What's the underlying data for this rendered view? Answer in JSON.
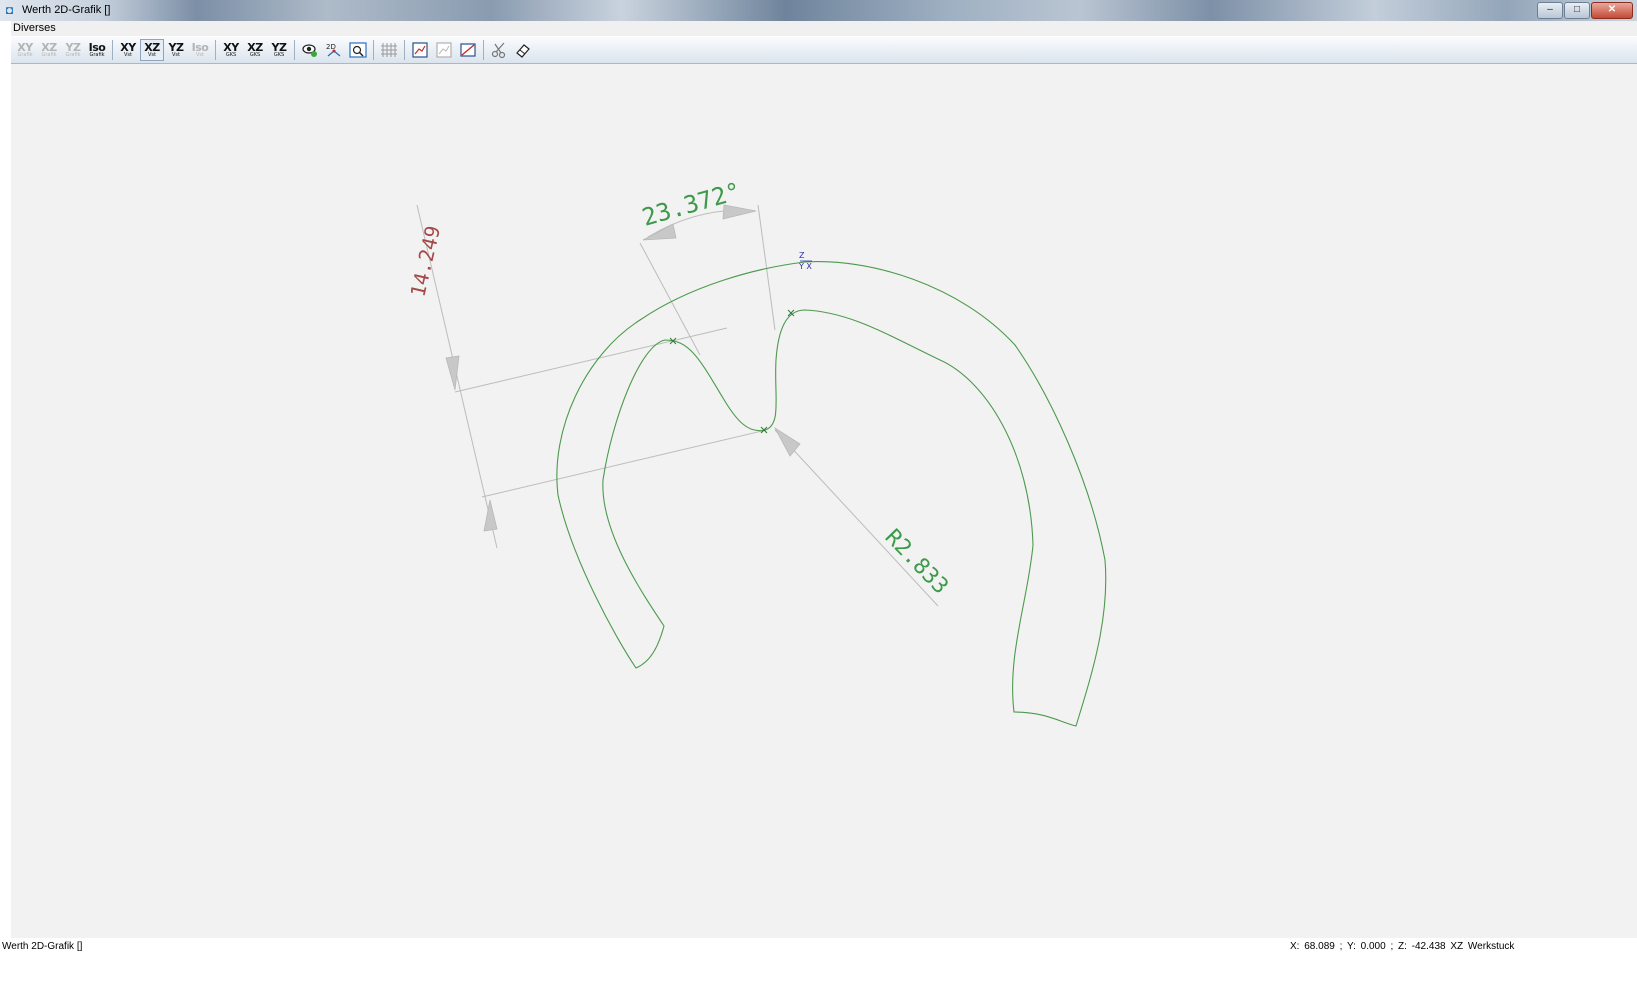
{
  "window": {
    "title": "Werth 2D-Grafik []"
  },
  "menu": {
    "items": [
      "Diverses"
    ]
  },
  "toolbar": {
    "buttons": [
      {
        "label": "XY",
        "sub": "Grafik",
        "state": "disabled"
      },
      {
        "label": "XZ",
        "sub": "Grafik",
        "state": "disabled"
      },
      {
        "label": "YZ",
        "sub": "Grafik",
        "state": "disabled"
      },
      {
        "label": "Iso",
        "sub": "Grafik",
        "state": "enabled"
      },
      {
        "label": "XY",
        "sub": "Vst",
        "state": "enabled"
      },
      {
        "label": "XZ",
        "sub": "Vst",
        "state": "active"
      },
      {
        "label": "YZ",
        "sub": "Vst",
        "state": "enabled"
      },
      {
        "label": "Iso",
        "sub": "Vst",
        "state": "disabled"
      },
      {
        "label": "XY",
        "sub": "GKS",
        "state": "enabled"
      },
      {
        "label": "XZ",
        "sub": "GKS",
        "state": "enabled"
      },
      {
        "label": "YZ",
        "sub": "GKS",
        "state": "enabled"
      }
    ],
    "icons": [
      "eye-icon",
      "point-dimension-icon",
      "zoom-fit-icon",
      "grid-icon",
      "graph-icon",
      "graph-disabled-icon",
      "edit-graph-icon",
      "scissors-icon",
      "eraser-icon"
    ]
  },
  "drawing": {
    "dim_angle": "23.372°",
    "dim_length": "14.249",
    "dim_radius": "R2.833",
    "axis_z": "Z",
    "axis_yx": "Y X",
    "colors": {
      "contour": "#4c9a4c",
      "dimension_green": "#3d9a4a",
      "dimension_red": "#a54848",
      "extension_line": "#bcbcbc",
      "axis_marker": "#2d2db4"
    }
  },
  "status": {
    "left": "Werth 2D-Grafik []",
    "coords": "X:  68.089 ; Y:   0.000 ; Z:  -42.438  XZ Werkstuck"
  }
}
